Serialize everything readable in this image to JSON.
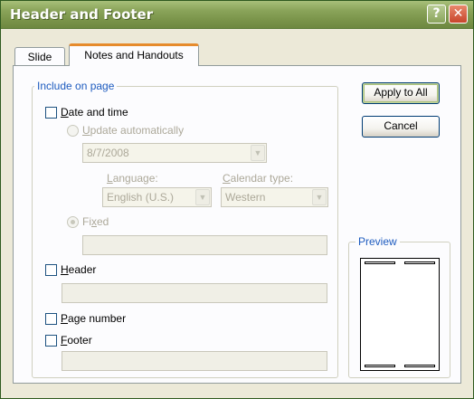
{
  "window": {
    "title": "Header and Footer",
    "help": "?",
    "close": "✕"
  },
  "tabs": [
    {
      "label": "Slide"
    },
    {
      "label": "Notes and Handouts"
    }
  ],
  "include": {
    "legend": "Include on page",
    "date_time": {
      "label_underlined": "D",
      "label_rest": "ate and time",
      "checked": false
    },
    "update_auto": {
      "label_underlined": "U",
      "label_rest": "pdate automatically"
    },
    "date_value": "8/7/2008",
    "language": {
      "label_underlined": "L",
      "label_rest": "anguage:",
      "value": "English (U.S.)"
    },
    "calendar": {
      "label_underlined": "C",
      "label_rest": "alendar type:",
      "value": "Western"
    },
    "fixed": {
      "label_pre": "Fi",
      "label_underlined": "x",
      "label_rest": "ed"
    },
    "header": {
      "label_underlined": "H",
      "label_rest": "eader",
      "checked": false
    },
    "page_number": {
      "label_underlined": "P",
      "label_rest": "age number",
      "checked": false
    },
    "footer": {
      "label_underlined": "F",
      "label_rest": "ooter",
      "checked": false
    }
  },
  "buttons": {
    "apply_all": "Apply to All",
    "cancel": "Cancel"
  },
  "preview": {
    "legend": "Preview"
  },
  "icons": {
    "dropdown_arrow": "▼"
  },
  "colors": {
    "titlebar": "#8aa45a",
    "tab_accent": "#e68b2c",
    "group_label": "#1d5bbf"
  }
}
